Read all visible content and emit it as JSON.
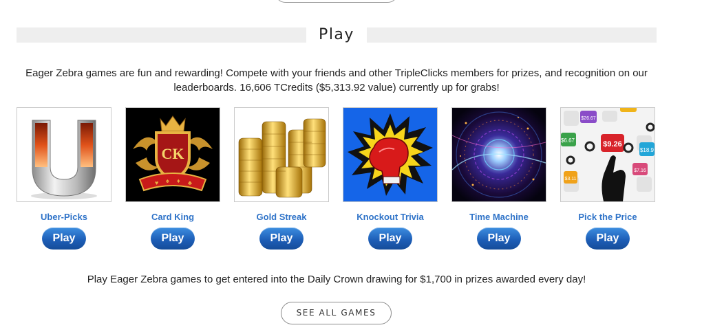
{
  "section": {
    "title": "Play"
  },
  "intro": "Eager Zebra games are fun and rewarding! Compete with your friends and other TripleClicks members for prizes, and recognition on our leaderboards. 16,606 TCredits ($5,313.92 value) currently up for grabs!",
  "games": [
    {
      "name": "Uber-Picks",
      "play_label": "Play"
    },
    {
      "name": "Card King",
      "play_label": "Play",
      "logo_text": "CK"
    },
    {
      "name": "Gold Streak",
      "play_label": "Play"
    },
    {
      "name": "Knockout Trivia",
      "play_label": "Play"
    },
    {
      "name": "Time Machine",
      "play_label": "Play"
    },
    {
      "name": "Pick the Price",
      "play_label": "Play",
      "price_tags": [
        "$26.67",
        "$6.67",
        "$9.26",
        "$18.9",
        "$7.16",
        "$3.11"
      ]
    }
  ],
  "daily_crown": "Play Eager Zebra games to get entered into the Daily Crown drawing for $1,700 in prizes awarded every day!",
  "see_all_label": "SEE ALL GAMES",
  "colors": {
    "link": "#2f73c8",
    "play_button": "#1e5fb8",
    "header_bar": "#eeeeee"
  }
}
